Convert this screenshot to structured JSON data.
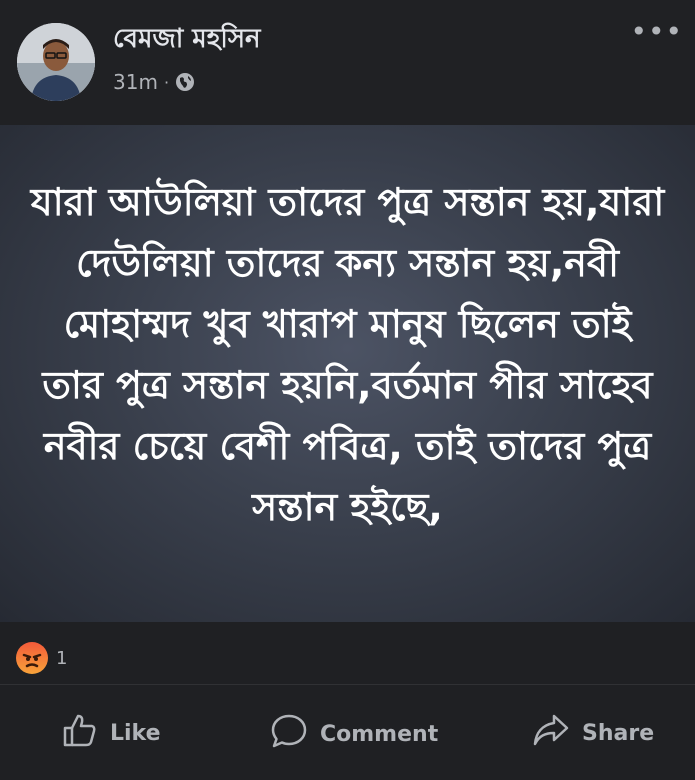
{
  "post": {
    "author": "বেমজা মহসিন",
    "time": "31m",
    "separator": "·",
    "privacy_icon": "globe-icon",
    "more_icon": "more-options-icon",
    "more_label": "•••"
  },
  "card": {
    "text": "যারা আউলিয়া তাদের পুত্র সন্তান হয়,যারা দেউলিয়া তাদের কন্য সন্তান হয়,নবী মোহাম্মদ খুব খারাপ মানুষ ছিলেন তাই তার পুত্র সন্তান হয়নি,বর্তমান পীর সাহেব নবীর চেয়ে বেশী পবিত্র, তাই তাদের পুত্র সন্তান হইছে,"
  },
  "reactions": {
    "icon": "angry-reaction-icon",
    "count": "1"
  },
  "actions": {
    "like": "Like",
    "comment": "Comment",
    "share": "Share"
  },
  "colors": {
    "background": "#1f2023",
    "card_center": "#4c5364",
    "card_edge": "#262a33",
    "text_primary": "#e4e6eb",
    "text_secondary": "#b0b3b8",
    "angry_top": "#f35a3a",
    "angry_bottom": "#f8a33a"
  }
}
